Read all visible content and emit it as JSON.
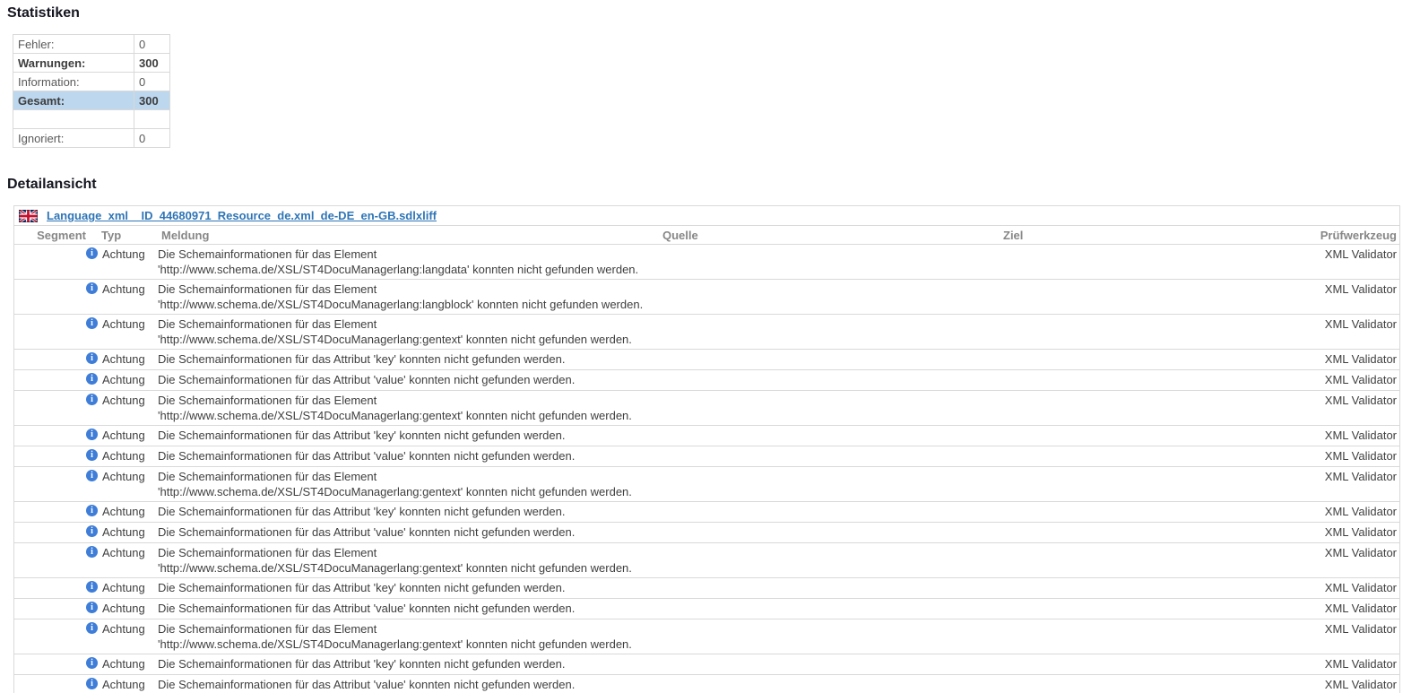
{
  "colors": {
    "highlight_row": "#bdd7ee",
    "link": "#2e75b6",
    "info_icon": "#3e7dd8",
    "border": "#d9d9d9",
    "header_text": "#878787",
    "body_text": "#3f3f3f"
  },
  "icons": {
    "info_glyph": "i"
  },
  "statistics": {
    "title": "Statistiken",
    "rows": [
      {
        "label": "Fehler:",
        "value": "0",
        "bold": false,
        "highlight": false
      },
      {
        "label": "Warnungen:",
        "value": "300",
        "bold": true,
        "highlight": false
      },
      {
        "label": "Information:",
        "value": "0",
        "bold": false,
        "highlight": false
      },
      {
        "label": "Gesamt:",
        "value": "300",
        "bold": true,
        "highlight": true
      },
      {
        "label": "",
        "value": "",
        "bold": false,
        "highlight": false
      },
      {
        "label": "Ignoriert:",
        "value": "0",
        "bold": false,
        "highlight": false
      }
    ]
  },
  "details": {
    "title": "Detailansicht",
    "file": {
      "flag_icon": "uk-flag-icon",
      "name": "Language_xml__ID_44680971_Resource_de.xml_de-DE_en-GB.sdlxliff"
    },
    "columns": [
      "Segment",
      "Typ",
      "Meldung",
      "Quelle",
      "Ziel",
      "Prüfwerkzeug"
    ],
    "rows": [
      {
        "segment": "",
        "icon": "info-icon",
        "typ": "Achtung",
        "message": [
          "Die Schemainformationen für das Element",
          "'http://www.schema.de/XSL/ST4DocuManagerlang:langdata' konnten nicht gefunden werden."
        ],
        "quelle": "",
        "ziel": "",
        "tool": "XML Validator"
      },
      {
        "segment": "",
        "icon": "info-icon",
        "typ": "Achtung",
        "message": [
          "Die Schemainformationen für das Element",
          "'http://www.schema.de/XSL/ST4DocuManagerlang:langblock' konnten nicht gefunden werden."
        ],
        "quelle": "",
        "ziel": "",
        "tool": "XML Validator"
      },
      {
        "segment": "",
        "icon": "info-icon",
        "typ": "Achtung",
        "message": [
          "Die Schemainformationen für das Element",
          "'http://www.schema.de/XSL/ST4DocuManagerlang:gentext' konnten nicht gefunden werden."
        ],
        "quelle": "",
        "ziel": "",
        "tool": "XML Validator"
      },
      {
        "segment": "",
        "icon": "info-icon",
        "typ": "Achtung",
        "message": [
          "Die Schemainformationen für das Attribut 'key' konnten nicht gefunden werden."
        ],
        "quelle": "",
        "ziel": "",
        "tool": "XML Validator"
      },
      {
        "segment": "",
        "icon": "info-icon",
        "typ": "Achtung",
        "message": [
          "Die Schemainformationen für das Attribut 'value' konnten nicht gefunden werden."
        ],
        "quelle": "",
        "ziel": "",
        "tool": "XML Validator"
      },
      {
        "segment": "",
        "icon": "info-icon",
        "typ": "Achtung",
        "message": [
          "Die Schemainformationen für das Element",
          "'http://www.schema.de/XSL/ST4DocuManagerlang:gentext' konnten nicht gefunden werden."
        ],
        "quelle": "",
        "ziel": "",
        "tool": "XML Validator"
      },
      {
        "segment": "",
        "icon": "info-icon",
        "typ": "Achtung",
        "message": [
          "Die Schemainformationen für das Attribut 'key' konnten nicht gefunden werden."
        ],
        "quelle": "",
        "ziel": "",
        "tool": "XML Validator"
      },
      {
        "segment": "",
        "icon": "info-icon",
        "typ": "Achtung",
        "message": [
          "Die Schemainformationen für das Attribut 'value' konnten nicht gefunden werden."
        ],
        "quelle": "",
        "ziel": "",
        "tool": "XML Validator"
      },
      {
        "segment": "",
        "icon": "info-icon",
        "typ": "Achtung",
        "message": [
          "Die Schemainformationen für das Element",
          "'http://www.schema.de/XSL/ST4DocuManagerlang:gentext' konnten nicht gefunden werden."
        ],
        "quelle": "",
        "ziel": "",
        "tool": "XML Validator"
      },
      {
        "segment": "",
        "icon": "info-icon",
        "typ": "Achtung",
        "message": [
          "Die Schemainformationen für das Attribut 'key' konnten nicht gefunden werden."
        ],
        "quelle": "",
        "ziel": "",
        "tool": "XML Validator"
      },
      {
        "segment": "",
        "icon": "info-icon",
        "typ": "Achtung",
        "message": [
          "Die Schemainformationen für das Attribut 'value' konnten nicht gefunden werden."
        ],
        "quelle": "",
        "ziel": "",
        "tool": "XML Validator"
      },
      {
        "segment": "",
        "icon": "info-icon",
        "typ": "Achtung",
        "message": [
          "Die Schemainformationen für das Element",
          "'http://www.schema.de/XSL/ST4DocuManagerlang:gentext' konnten nicht gefunden werden."
        ],
        "quelle": "",
        "ziel": "",
        "tool": "XML Validator"
      },
      {
        "segment": "",
        "icon": "info-icon",
        "typ": "Achtung",
        "message": [
          "Die Schemainformationen für das Attribut 'key' konnten nicht gefunden werden."
        ],
        "quelle": "",
        "ziel": "",
        "tool": "XML Validator"
      },
      {
        "segment": "",
        "icon": "info-icon",
        "typ": "Achtung",
        "message": [
          "Die Schemainformationen für das Attribut 'value' konnten nicht gefunden werden."
        ],
        "quelle": "",
        "ziel": "",
        "tool": "XML Validator"
      },
      {
        "segment": "",
        "icon": "info-icon",
        "typ": "Achtung",
        "message": [
          "Die Schemainformationen für das Element",
          "'http://www.schema.de/XSL/ST4DocuManagerlang:gentext' konnten nicht gefunden werden."
        ],
        "quelle": "",
        "ziel": "",
        "tool": "XML Validator"
      },
      {
        "segment": "",
        "icon": "info-icon",
        "typ": "Achtung",
        "message": [
          "Die Schemainformationen für das Attribut 'key' konnten nicht gefunden werden."
        ],
        "quelle": "",
        "ziel": "",
        "tool": "XML Validator"
      },
      {
        "segment": "",
        "icon": "info-icon",
        "typ": "Achtung",
        "message": [
          "Die Schemainformationen für das Attribut 'value' konnten nicht gefunden werden."
        ],
        "quelle": "",
        "ziel": "",
        "tool": "XML Validator"
      }
    ]
  }
}
